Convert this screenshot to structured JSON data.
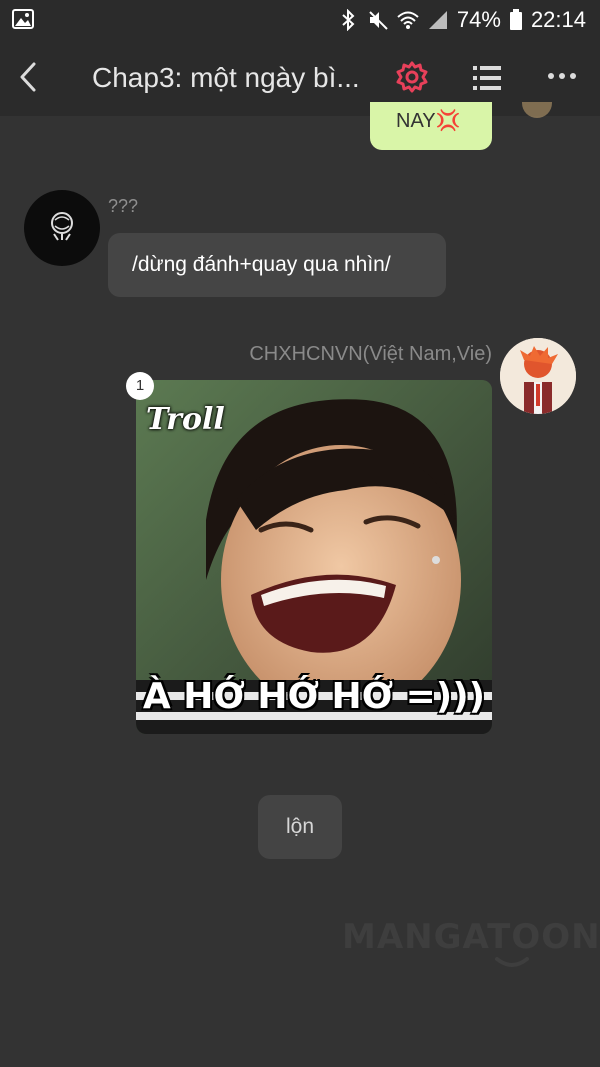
{
  "status_bar": {
    "battery": "74%",
    "time": "22:14",
    "icons": [
      "image-icon",
      "bluetooth-icon",
      "mute-icon",
      "wifi-icon",
      "signal-icon",
      "battery-icon"
    ]
  },
  "app_bar": {
    "title": "Chap3: một ngày bì...",
    "icons": [
      "back-icon",
      "gear-icon",
      "list-icon",
      "more-icon"
    ],
    "accent": "#e8405a"
  },
  "chat": {
    "previous_bubble_text": "NAY💢",
    "messages": [
      {
        "sender": "???",
        "text": "/dừng đánh+quay qua nhìn/"
      },
      {
        "sender": "CHXHCNVN(Việt Nam,Vie)",
        "image_badge": "1",
        "image_caption": "À HỚ HỚ HỚ =)))",
        "image_logo": "Troll"
      }
    ],
    "chip_text": "lộn"
  },
  "watermark": "MANGATOON",
  "colors": {
    "background": "#333333",
    "bubble_left": "#454545",
    "bubble_right": "#d9f5a8"
  }
}
